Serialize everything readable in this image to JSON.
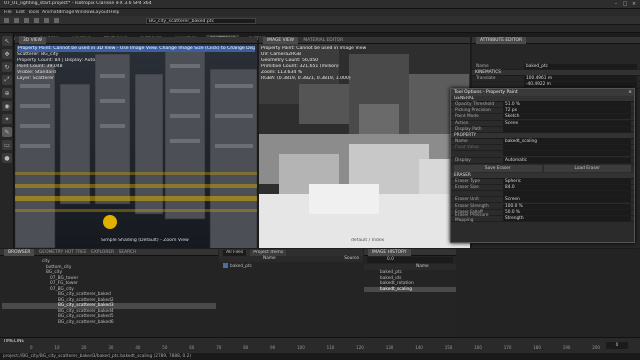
{
  "window": {
    "title": "07_01_lighting_start.project* - Isotropix Clarisse iFX 3.6 SP4 x64"
  },
  "menubar": [
    "File",
    "Edit",
    "Tools",
    "Animate",
    "Image",
    "Window",
    "Layout",
    "Help"
  ],
  "tabs": [
    "ADVANCED",
    "SHADERS",
    "LIGHTING",
    "TEXTURING",
    "PARTICLES",
    "ANIMATION",
    "SCATTERING",
    "CUSTOM"
  ],
  "tabs_active": "SCATTERING",
  "toolbar": {
    "selector_value": "BG_city_scatterer_baked.ptc"
  },
  "view3d": {
    "tab": "3D VIEW",
    "info": [
      "Property Point: Cannot be used in 3D View - Use Image View. Change Image Size (Click) to Change Display",
      "Scatterer: BG_city",
      "Property Count: 84 | Display: Auto",
      "Point Count: 39,048",
      "Visible: Standard",
      "Layer: Scatterer"
    ],
    "footer": "Simple Shading (Default) - Zoom View",
    "accent": "#e0b000"
  },
  "imgview": {
    "tabs": [
      "IMAGE VIEW",
      "MATERIAL EDITOR"
    ],
    "info": [
      "Property Paint: Cannot be used in Image View",
      "UV: Camera2RGB",
      "Geometry Count: 56,050",
      "Primitive Count: 321,651 (million)",
      "Zoom: 113.634 %",
      "RGBA: (0.3819, 0.3821, 0.3819, 1.000)"
    ],
    "footer": "default / Index"
  },
  "attribute_editor": {
    "tab": "ATTRIBUTE EDITOR",
    "name_label": "Name",
    "name_value": "baked_ptc",
    "section": "KINEMATICS",
    "rows": [
      {
        "k": "Translate",
        "v": "100.4961  m"
      },
      {
        "k": "",
        "v": "-40.4922  m"
      }
    ]
  },
  "tool_options": {
    "title": "Tool Options - Property Paint",
    "general": {
      "label": "GENERAL",
      "rows": [
        {
          "k": "Opacity Threshold",
          "v": "51.0 %"
        },
        {
          "k": "Picking Precision",
          "v": "72 px"
        },
        {
          "k": "Paint Mode",
          "v": "Sketch"
        },
        {
          "k": "Action",
          "v": "Scene"
        },
        {
          "k": "Display Path",
          "v": ""
        }
      ]
    },
    "property": {
      "label": "PROPERTY",
      "rows": [
        {
          "k": "Name",
          "v": "bakedt_scaling"
        },
        {
          "k": "Float Value",
          "v": ""
        },
        {
          "k": "",
          "v": ""
        },
        {
          "k": "Display",
          "v": "Automatic"
        }
      ]
    },
    "buttons": [
      "Save Eraser",
      "Load Eraser"
    ],
    "eraser": {
      "label": "ERASER",
      "rows": [
        {
          "k": "Eraser Type",
          "v": "Spheric"
        },
        {
          "k": "Eraser Size",
          "v": "84.0"
        },
        {
          "k": "",
          "v": ""
        },
        {
          "k": "Eraser Unit",
          "v": "Screen"
        },
        {
          "k": "Eraser Strength",
          "v": "100.0 %"
        },
        {
          "k": "Eraser Falloff",
          "v": "50.0 %"
        },
        {
          "k": "Eraser Pressure Mapping",
          "v": "Strength"
        }
      ]
    }
  },
  "browser": {
    "tabs": [
      "BROWSER",
      "GEOMETRY HOT TREE",
      "EXPLORER",
      "SEARCH"
    ],
    "items": [
      {
        "label": "city",
        "depth": 0,
        "sel": false
      },
      {
        "label": "bottom_city",
        "depth": 1,
        "sel": false
      },
      {
        "label": "BG_city",
        "depth": 1,
        "sel": false
      },
      {
        "label": "07_BG_tower",
        "depth": 2,
        "sel": false
      },
      {
        "label": "07_FG_tower",
        "depth": 2,
        "sel": false
      },
      {
        "label": "07_BG_city",
        "depth": 2,
        "sel": false
      },
      {
        "label": "BG_city_scatterer_baked",
        "depth": 3,
        "sel": false
      },
      {
        "label": "BG_city_scatterer_baked2",
        "depth": 3,
        "sel": false
      },
      {
        "label": "BG_city_scatterer_baked3",
        "depth": 3,
        "sel": true
      },
      {
        "label": "BG_city_scatterer_baked4",
        "depth": 3,
        "sel": false
      },
      {
        "label": "BG_city_scatterer_baked5",
        "depth": 3,
        "sel": false
      },
      {
        "label": "BG_city_scatterer_baked6",
        "depth": 3,
        "sel": false
      }
    ]
  },
  "layers": {
    "filter": "All Files",
    "header_btn": "Project Items",
    "col_name": "Name",
    "col_source": "Source",
    "items": [
      "baked_ptc"
    ]
  },
  "groups": {
    "tab": "IMAGE HISTORY",
    "value": "0.0",
    "col": "Name",
    "items": [
      {
        "label": "baked_ptc",
        "sel": false
      },
      {
        "label": "baked_ids",
        "sel": false
      },
      {
        "label": "bakedt_rotation",
        "sel": false
      },
      {
        "label": "bakedt_scaling",
        "sel": true
      }
    ]
  },
  "timeline": {
    "label": "TIMELINE",
    "ticks": [
      "0",
      "10",
      "20",
      "30",
      "40",
      "50",
      "60",
      "70",
      "80",
      "90",
      "100",
      "110",
      "120",
      "130",
      "140",
      "150",
      "160",
      "170",
      "180",
      "190",
      "200"
    ],
    "frame": "0"
  },
  "status": {
    "text": "project://BG_city/BG_city_scatterer_baked3/baked_ptc.bakedt_scaling  (2789, 7888, 0.2)"
  }
}
